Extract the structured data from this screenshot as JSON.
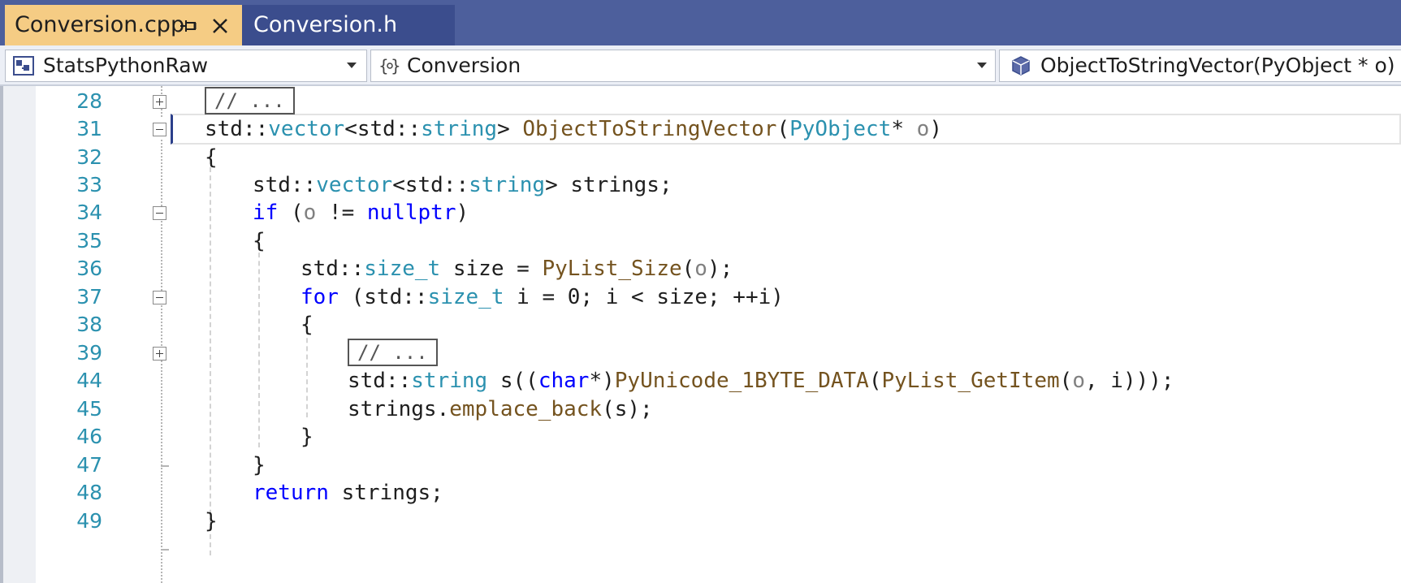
{
  "tabs": [
    {
      "label": "Conversion.cpp",
      "active": true,
      "pinned": true
    },
    {
      "label": "Conversion.h",
      "active": false
    }
  ],
  "nav": {
    "project": "StatsPythonRaw",
    "scope": "Conversion",
    "member": "ObjectToStringVector(PyObject * o)"
  },
  "editor": {
    "collapsed_placeholder": "// ...",
    "lines": [
      {
        "num": "28",
        "fold": "plus",
        "collapsed": true
      },
      {
        "num": "31",
        "fold": "minus",
        "current": true
      },
      {
        "num": "32"
      },
      {
        "num": "33"
      },
      {
        "num": "34",
        "fold": "minus"
      },
      {
        "num": "35"
      },
      {
        "num": "36"
      },
      {
        "num": "37",
        "fold": "minus"
      },
      {
        "num": "38"
      },
      {
        "num": "39",
        "fold": "plus",
        "collapsed": true
      },
      {
        "num": "44"
      },
      {
        "num": "45"
      },
      {
        "num": "46"
      },
      {
        "num": "47"
      },
      {
        "num": "48"
      },
      {
        "num": "49"
      }
    ],
    "tokens": {
      "std": "std",
      "vector": "vector",
      "string": "string",
      "size_t": "size_t",
      "func_name": "ObjectToStringVector",
      "pyobject": "PyObject",
      "o": "o",
      "i": "i",
      "strings": "strings",
      "size": "size",
      "s": "s",
      "kw_if": "if",
      "kw_nullptr": "nullptr",
      "kw_for": "for",
      "kw_char": "char",
      "kw_return": "return",
      "zero": "0",
      "pylist_size": "PyList_Size",
      "pyunicode": "PyUnicode_1BYTE_DATA",
      "pylist_getitem": "PyList_GetItem",
      "emplace_back": "emplace_back"
    }
  },
  "colors": {
    "tab_strip": "#4d5f9c",
    "active_tab": "#f5cc84",
    "line_number": "#2b91af",
    "type": "#2b91af",
    "function": "#74531f",
    "keyword": "#0000ff",
    "parameter": "#808080"
  },
  "icons": {
    "pin": "pin-icon",
    "close": "close-icon",
    "project": "project-icon",
    "scope": "namespace-icon",
    "member": "method-icon"
  }
}
